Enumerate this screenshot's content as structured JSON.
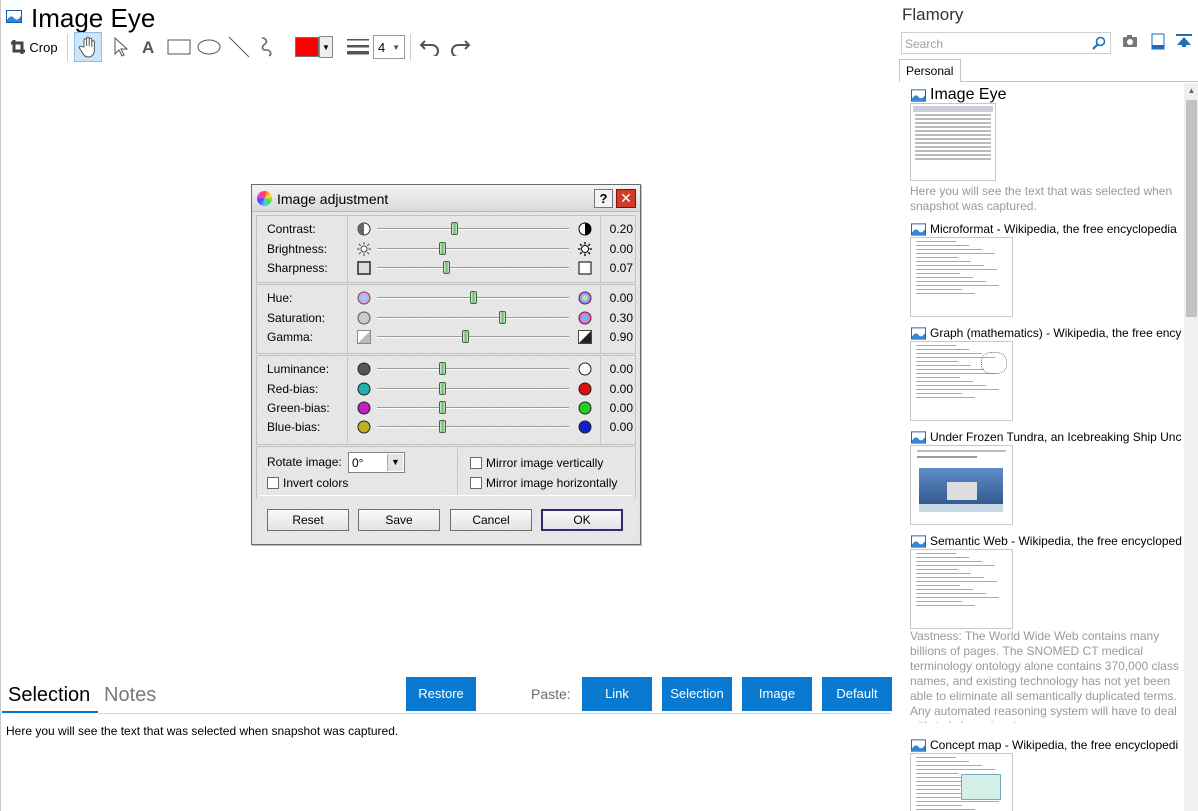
{
  "app": {
    "title": "Image Eye"
  },
  "toolbar": {
    "crop_label": "Crop",
    "line_width": "4",
    "active_color": "#ff0000",
    "icons": [
      "crop-icon",
      "hand-icon",
      "pointer-icon",
      "text-icon",
      "rectangle-icon",
      "ellipse-icon",
      "line-icon",
      "freehand-icon",
      "line-width-icon",
      "undo-icon",
      "redo-icon"
    ]
  },
  "dialog": {
    "title": "Image adjustment",
    "help": "?",
    "close": "✕",
    "group1": [
      {
        "label": "Contrast:",
        "value": "0.20",
        "pos": 0.4
      },
      {
        "label": "Brightness:",
        "value": "0.00",
        "pos": 0.34
      },
      {
        "label": "Sharpness:",
        "value": "0.07",
        "pos": 0.36
      }
    ],
    "group2": [
      {
        "label": "Hue:",
        "value": "0.00",
        "pos": 0.5
      },
      {
        "label": "Saturation:",
        "value": "0.30",
        "pos": 0.65
      },
      {
        "label": "Gamma:",
        "value": "0.90",
        "pos": 0.46
      }
    ],
    "group3": [
      {
        "label": "Luminance:",
        "value": "0.00",
        "pos": 0.34
      },
      {
        "label": "Red-bias:",
        "value": "0.00",
        "pos": 0.34
      },
      {
        "label": "Green-bias:",
        "value": "0.00",
        "pos": 0.34
      },
      {
        "label": "Blue-bias:",
        "value": "0.00",
        "pos": 0.34
      }
    ],
    "rotate_label": "Rotate image:",
    "rotate_value": "0°",
    "invert_label": "Invert colors",
    "mirror_v_label": "Mirror image vertically",
    "mirror_h_label": "Mirror image horizontally",
    "buttons": {
      "reset": "Reset",
      "save": "Save",
      "cancel": "Cancel",
      "ok": "OK"
    }
  },
  "bottom": {
    "tabs": {
      "selection": "Selection",
      "notes": "Notes"
    },
    "restore": "Restore",
    "paste_label": "Paste:",
    "paste_buttons": {
      "link": "Link",
      "selection": "Selection",
      "image": "Image",
      "default": "Default"
    },
    "selection_text": "Here you will see the text that was selected when snapshot was captured."
  },
  "sidebar": {
    "brand": "Flamory",
    "search_placeholder": "Search",
    "tab": "Personal",
    "snapshots": [
      {
        "title": "Image Eye",
        "desc": "Here you will see the text that was selected when snapshot was captured."
      },
      {
        "title": "Microformat - Wikipedia, the free encyclopedia",
        "desc": ""
      },
      {
        "title": "Graph (mathematics) - Wikipedia, the free ency",
        "desc": ""
      },
      {
        "title": "Under Frozen Tundra, an Icebreaking Ship Unco",
        "desc": ""
      },
      {
        "title": "Semantic Web - Wikipedia, the free encycloped",
        "desc": "Vastness: The World Wide Web contains many billions of pages. The SNOMED CT medical terminology ontology alone contains 370,000 class names, and existing technology has not yet been able to eliminate all semantically duplicated terms. Any automated reasoning system will have to deal with truly huge inputs."
      },
      {
        "title": "Concept map - Wikipedia, the free encyclopedi",
        "desc": ""
      }
    ]
  },
  "colors": {
    "accent": "#0a79d0",
    "close": "#d23a2a",
    "thumb": "#6fb56f"
  }
}
